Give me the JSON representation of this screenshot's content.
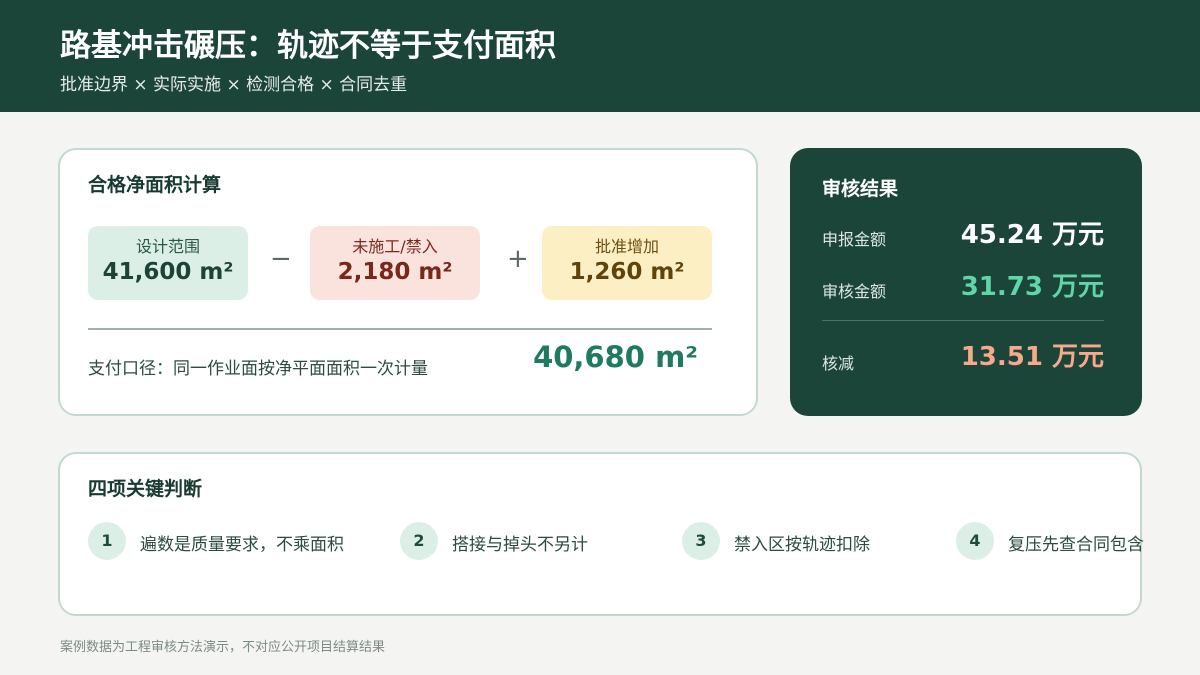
{
  "header": {
    "title": "路基冲击碾压：轨迹不等于支付面积",
    "subtitle": "批准边界 × 实际实施 × 检测合格 × 合同去重"
  },
  "calc": {
    "title": "合格净面积计算",
    "design": {
      "label": "设计范围",
      "value": "41,600 m²"
    },
    "minus": "−",
    "unbuilt": {
      "label": "未施工/禁入",
      "value": "2,180 m²"
    },
    "plus": "+",
    "added": {
      "label": "批准增加",
      "value": "1,260 m²"
    },
    "pay_label": "支付口径：同一作业面按净平面面积一次计量",
    "pay_value": "40,680 m²"
  },
  "result": {
    "title": "审核结果",
    "declared": {
      "label": "申报金额",
      "value": "45.24 万元"
    },
    "audited": {
      "label": "审核金额",
      "value": "31.73 万元"
    },
    "reduced": {
      "label": "核减",
      "value": "13.51 万元"
    }
  },
  "keys": {
    "title": "四项关键判断",
    "items": [
      {
        "num": "1",
        "text": "遍数是质量要求，不乘面积"
      },
      {
        "num": "2",
        "text": "搭接与掉头不另计"
      },
      {
        "num": "3",
        "text": "禁入区按轨迹扣除"
      },
      {
        "num": "4",
        "text": "复压先查合同包含"
      }
    ]
  },
  "footer": "案例数据为工程审核方法演示，不对应公开项目结算结果",
  "colors": {
    "header_bg": "#1b4539",
    "accent_green": "#1f7a60",
    "audited_green": "#5fd5a8",
    "reduced_orange": "#f7a98a"
  }
}
